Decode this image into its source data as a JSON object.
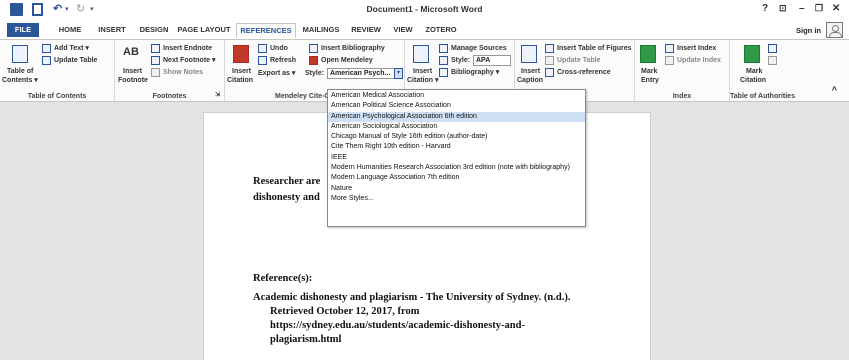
{
  "window": {
    "title": "Document1 - Microsoft Word",
    "help": "?",
    "ribbon_options": "⊡",
    "minimize": "–",
    "restore": "❐",
    "close": "✕"
  },
  "quick_access": {
    "undo": "↶",
    "redo": "↻",
    "undo_dropdown": "▾",
    "customize": "▾"
  },
  "tabs": [
    {
      "label": "FILE"
    },
    {
      "label": "HOME"
    },
    {
      "label": "INSERT"
    },
    {
      "label": "DESIGN"
    },
    {
      "label": "PAGE LAYOUT"
    },
    {
      "label": "REFERENCES"
    },
    {
      "label": "MAILINGS"
    },
    {
      "label": "REVIEW"
    },
    {
      "label": "VIEW"
    },
    {
      "label": "ZOTERO"
    }
  ],
  "signin": "Sign in",
  "ribbon": {
    "toc": {
      "table_of_contents": "Table of",
      "table_of_contents_2": "Contents ▾",
      "add_text": "Add Text ▾",
      "update_table": "Update Table",
      "group": "Table of Contents"
    },
    "footnotes": {
      "insert_footnote": "Insert",
      "insert_footnote_2": "Footnote",
      "insert_endnote": "Insert Endnote",
      "next_footnote": "Next Footnote ▾",
      "show_notes": "Show Notes",
      "group": "Footnotes",
      "launcher": "⇲",
      "ab_glyph": "AB"
    },
    "mendeley": {
      "insert_citation": "Insert",
      "insert_citation_2": "Citation",
      "undo": "Undo",
      "refresh": "Refresh",
      "export_as": "Export as ▾",
      "insert_bibliography": "Insert Bibliography",
      "open_mendeley": "Open Mendeley",
      "style_label": "Style:",
      "style_value": "American Psych...",
      "group": "Mendeley Cite-O-Matic"
    },
    "citations": {
      "insert_citation": "Insert",
      "insert_citation_2": "Citation ▾",
      "manage_sources": "Manage Sources",
      "style_label": "Style:",
      "style_value": "APA",
      "bibliography": "Bibliography ▾"
    },
    "captions": {
      "insert_caption": "Insert",
      "insert_caption_2": "Caption",
      "insert_table_of_figures": "Insert Table of Figures",
      "update_table": "Update Table",
      "cross_reference": "Cross-reference"
    },
    "index": {
      "mark_entry": "Mark",
      "mark_entry_2": "Entry",
      "insert_index": "Insert Index",
      "update_index": "Update Index",
      "group": "Index"
    },
    "authorities": {
      "mark_citation": "Mark",
      "mark_citation_2": "Citation",
      "group": "Table of Authorities"
    },
    "collapse": "^"
  },
  "style_dropdown": {
    "items": [
      "American Medical Association",
      "American Political Science Association",
      "American Psychological Association 6th edition",
      "American Sociological Association",
      "Chicago Manual of Style 16th edition (author-date)",
      "Cite Them Right 10th edition - Harvard",
      "IEEE",
      "Modern Humanities Research Association 3rd edition (note with bibliography)",
      "Modern Language Association 7th edition",
      "Nature",
      "More Styles..."
    ],
    "selected_index": 2
  },
  "document": {
    "line1": "Researcher are",
    "line2": "dishonesty and",
    "references_heading": "Reference(s):",
    "ref_line1": "Academic dishonesty and plagiarism - The University of Sydney. (n.d.).",
    "ref_line2": "Retrieved October 12, 2017, from",
    "ref_line3": "https://sydney.edu.au/students/academic-dishonesty-and-",
    "ref_line4": "plagiarism.html"
  }
}
